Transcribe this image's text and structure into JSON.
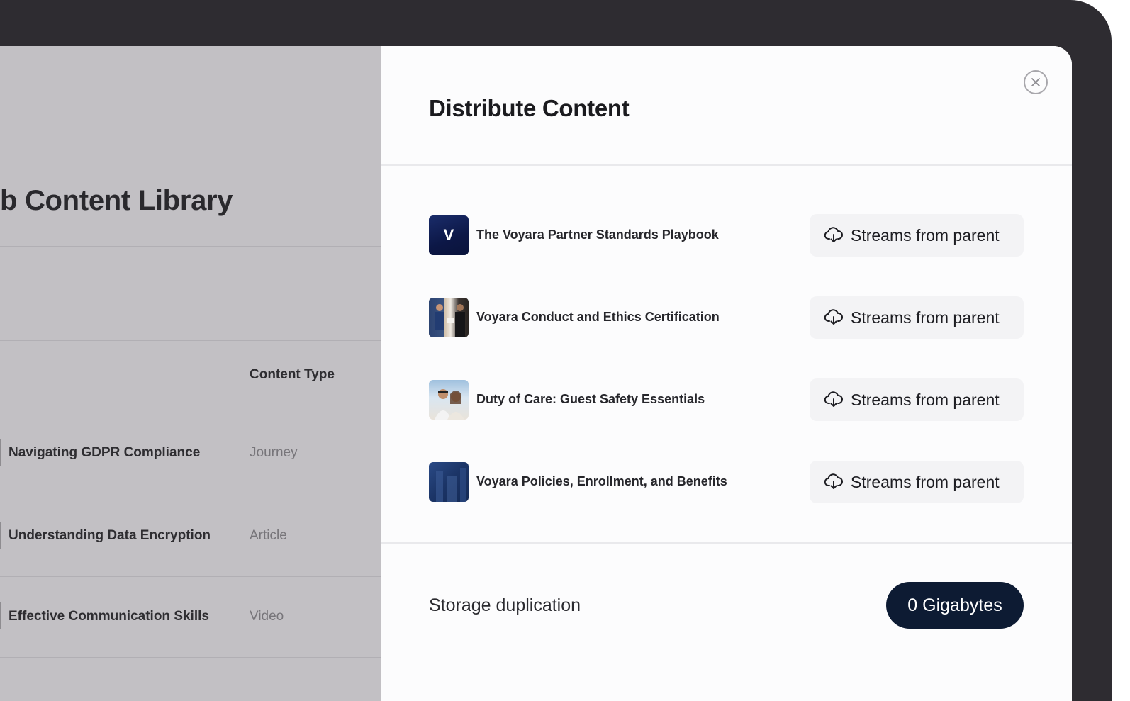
{
  "background_page": {
    "title": "b Content Library",
    "column_header": "Content Type",
    "rows": [
      {
        "name": "Navigating GDPR Compliance",
        "type": "Journey"
      },
      {
        "name": "Understanding Data Encryption",
        "type": "Article"
      },
      {
        "name": "Effective Communication Skills",
        "type": "Video"
      }
    ]
  },
  "drawer": {
    "title": "Distribute Content",
    "close_icon": "close-icon",
    "items": [
      {
        "title": "The Voyara Partner Standards Playbook",
        "thumb_letter": "V",
        "action": "Streams from parent",
        "icon": "cloud-download-icon"
      },
      {
        "title": "Voyara Conduct and Ethics Certification",
        "action": "Streams from parent",
        "icon": "cloud-download-icon"
      },
      {
        "title": "Duty of Care: Guest Safety Essentials",
        "action": "Streams from parent",
        "icon": "cloud-download-icon"
      },
      {
        "title": "Voyara Policies, Enrollment, and Benefits",
        "action": "Streams from parent",
        "icon": "cloud-download-icon"
      }
    ],
    "footer": {
      "label": "Storage duplication",
      "value": "0 Gigabytes"
    }
  },
  "colors": {
    "accent": "#0d1b33",
    "overlay": "#c2c0c4",
    "frame": "#2e2c31"
  }
}
